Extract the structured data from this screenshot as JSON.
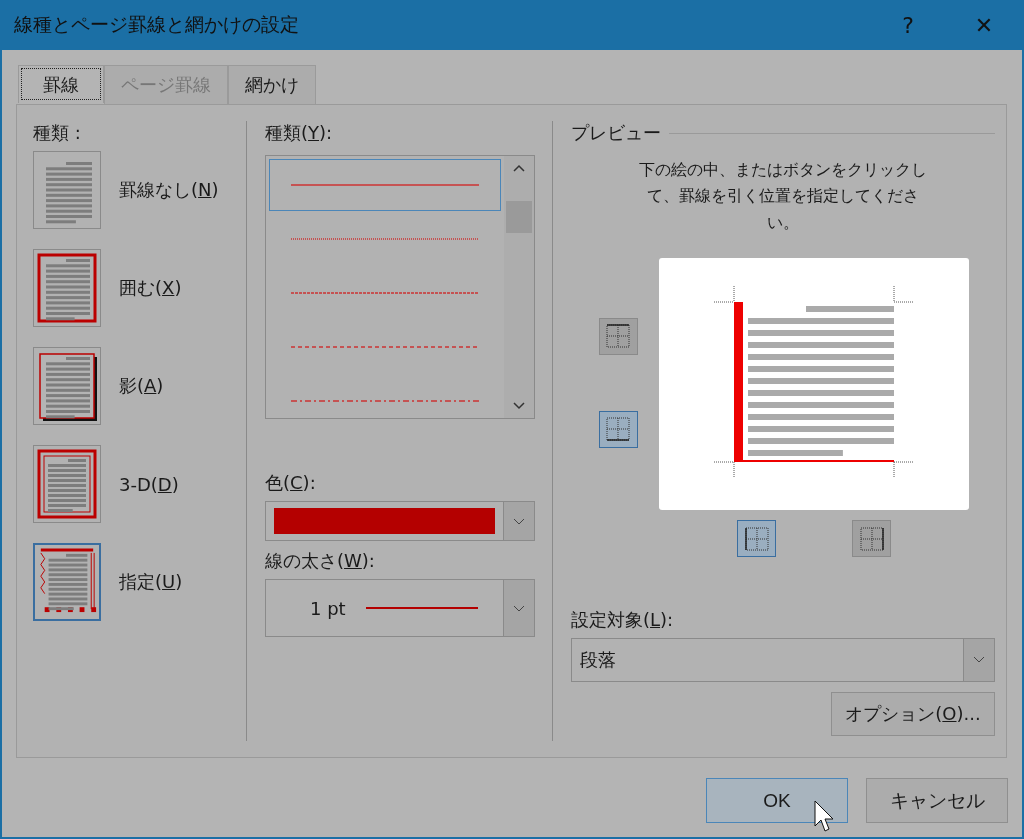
{
  "window": {
    "title": "線種とページ罫線と網かけの設定",
    "help": "?",
    "close": "✕"
  },
  "tabs": [
    {
      "label": "罫線",
      "selected": true,
      "disabled": false
    },
    {
      "label": "ページ罫線",
      "selected": false,
      "disabled": true
    },
    {
      "label": "網かけ",
      "selected": false,
      "disabled": false
    }
  ],
  "setting": {
    "label": "種類 :",
    "items": [
      {
        "kind": "none",
        "before": "罫線なし(",
        "key": "N",
        "after": ")",
        "selected": false
      },
      {
        "kind": "box",
        "before": "囲む(",
        "key": "X",
        "after": ")",
        "selected": false
      },
      {
        "kind": "shadow",
        "before": "影(",
        "key": "A",
        "after": ")",
        "selected": false
      },
      {
        "kind": "threed",
        "before": "3-D(",
        "key": "D",
        "after": ")",
        "selected": false
      },
      {
        "kind": "custom",
        "before": "指定(",
        "key": "U",
        "after": ")",
        "selected": true
      }
    ]
  },
  "style": {
    "before": "種類(",
    "key": "Y",
    "after": "):",
    "items": [
      {
        "kind": "solid",
        "selected": true
      },
      {
        "kind": "dotted",
        "selected": false
      },
      {
        "kind": "fine-dash",
        "selected": false
      },
      {
        "kind": "dashed",
        "selected": false
      },
      {
        "kind": "dash-dot",
        "selected": false
      }
    ]
  },
  "color": {
    "before": "色(",
    "key": "C",
    "after": "):",
    "color": "#b40000"
  },
  "width": {
    "before": "線の太さ(",
    "key": "W",
    "after": "):",
    "value": "1 pt"
  },
  "preview": {
    "title": "プレビュー",
    "instructions": "下の絵の中、またはボタンをクリックして、罫線を引く位置を指定してください。",
    "edges": [
      {
        "kind": "top",
        "selected": false
      },
      {
        "kind": "bottom",
        "selected": true
      },
      {
        "kind": "left",
        "selected": true
      },
      {
        "kind": "right",
        "selected": false
      }
    ]
  },
  "apply_to": {
    "before": "設定対象(",
    "key": "L",
    "after": "):",
    "value": "段落"
  },
  "options_button": {
    "before": "オプション(",
    "key": "O",
    "after": ")..."
  },
  "buttons": [
    {
      "label": "OK",
      "kind": "default"
    },
    {
      "label": "キャンセル",
      "kind": "normal"
    }
  ]
}
